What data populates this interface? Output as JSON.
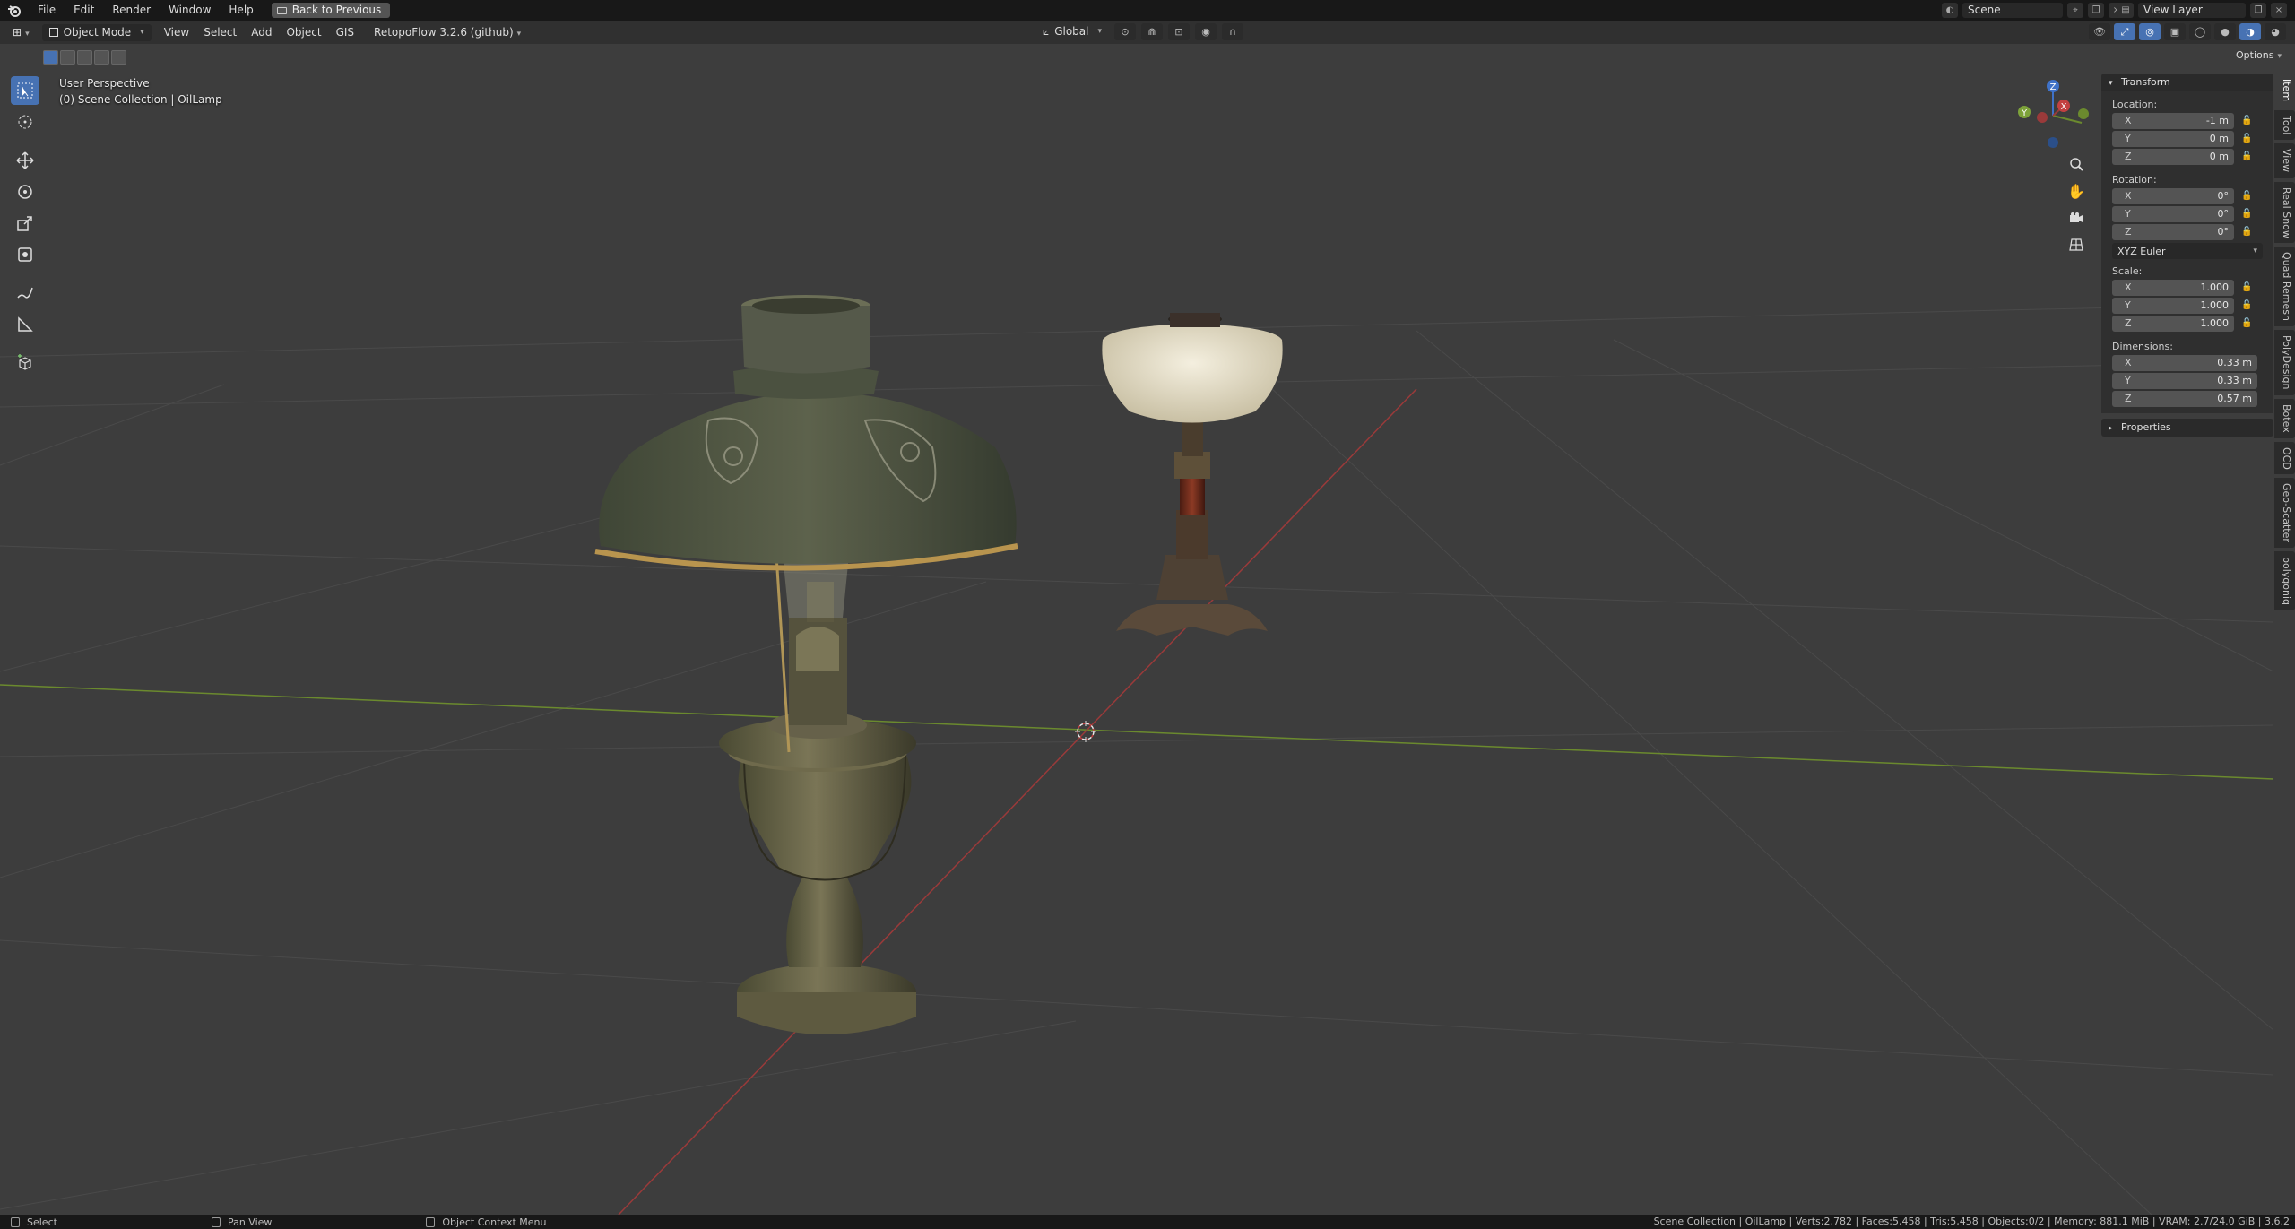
{
  "menubar": {
    "items": [
      "File",
      "Edit",
      "Render",
      "Window",
      "Help"
    ],
    "back_button": "Back to Previous",
    "scene": "Scene",
    "view_layer": "View Layer"
  },
  "header": {
    "mode": "Object Mode",
    "menus": [
      "View",
      "Select",
      "Add",
      "Object",
      "GIS"
    ],
    "addon": "RetopoFlow 3.2.6 (github)",
    "transform_orientation": "Global",
    "options": "Options"
  },
  "viewport": {
    "perspective": "User Perspective",
    "collection": "(0) Scene Collection | OilLamp"
  },
  "gizmo": {
    "x": "X",
    "y": "Y",
    "z": "Z"
  },
  "npanel": {
    "title": "Transform",
    "location_label": "Location:",
    "location": [
      {
        "axis": "X",
        "value": "-1 m"
      },
      {
        "axis": "Y",
        "value": "0 m"
      },
      {
        "axis": "Z",
        "value": "0 m"
      }
    ],
    "rotation_label": "Rotation:",
    "rotation": [
      {
        "axis": "X",
        "value": "0°"
      },
      {
        "axis": "Y",
        "value": "0°"
      },
      {
        "axis": "Z",
        "value": "0°"
      }
    ],
    "rotation_mode": "XYZ Euler",
    "scale_label": "Scale:",
    "scale": [
      {
        "axis": "X",
        "value": "1.000"
      },
      {
        "axis": "Y",
        "value": "1.000"
      },
      {
        "axis": "Z",
        "value": "1.000"
      }
    ],
    "dimensions_label": "Dimensions:",
    "dimensions": [
      {
        "axis": "X",
        "value": "0.33 m"
      },
      {
        "axis": "Y",
        "value": "0.33 m"
      },
      {
        "axis": "Z",
        "value": "0.57 m"
      }
    ],
    "properties": "Properties"
  },
  "vtabs": [
    "Item",
    "Tool",
    "View",
    "Real Snow",
    "Quad Remesh",
    "PolyDesign",
    "Botex",
    "OCD",
    "Geo-Scatter",
    "polygoniq"
  ],
  "statusbar": {
    "select": "Select",
    "pan": "Pan View",
    "context": "Object Context Menu",
    "info": "Scene Collection | OilLamp | Verts:2,782 | Faces:5,458 | Tris:5,458 | Objects:0/2 | Memory: 881.1 MiB | VRAM: 2.7/24.0 GiB | 3.6.2"
  },
  "colors": {
    "accent": "#4772b3",
    "x_axis": "#9a3a3a",
    "y_axis": "#6b8a2e",
    "z_axis": "#3f72c8"
  }
}
